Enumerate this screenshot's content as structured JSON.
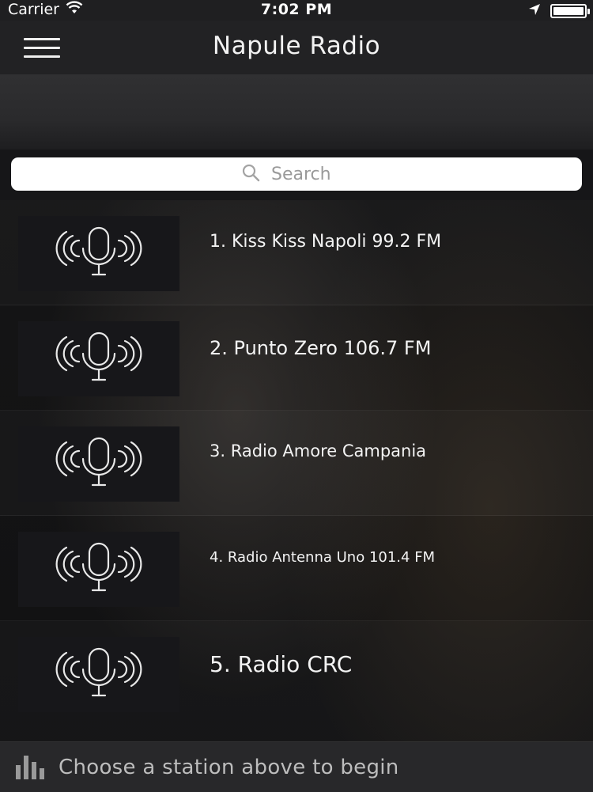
{
  "status_bar": {
    "carrier": "Carrier",
    "time": "7:02 PM",
    "battery_level": 1.0
  },
  "nav": {
    "title": "Napule Radio",
    "menu_icon": "hamburger-menu-icon"
  },
  "search": {
    "placeholder": "Search",
    "icon": "search-icon"
  },
  "stations": [
    {
      "name": "1. Kiss Kiss Napoli 99.2 FM",
      "icon": "microphone-broadcast-icon"
    },
    {
      "name": "2. Punto Zero 106.7 FM",
      "icon": "microphone-broadcast-icon"
    },
    {
      "name": "3. Radio Amore Campania",
      "icon": "microphone-broadcast-icon"
    },
    {
      "name": "4. Radio Antenna Uno 101.4 FM",
      "icon": "microphone-broadcast-icon"
    },
    {
      "name": "5. Radio CRC",
      "icon": "microphone-broadcast-icon"
    }
  ],
  "footer": {
    "text": "Choose a station above to begin",
    "icon": "equalizer-bars-icon"
  }
}
